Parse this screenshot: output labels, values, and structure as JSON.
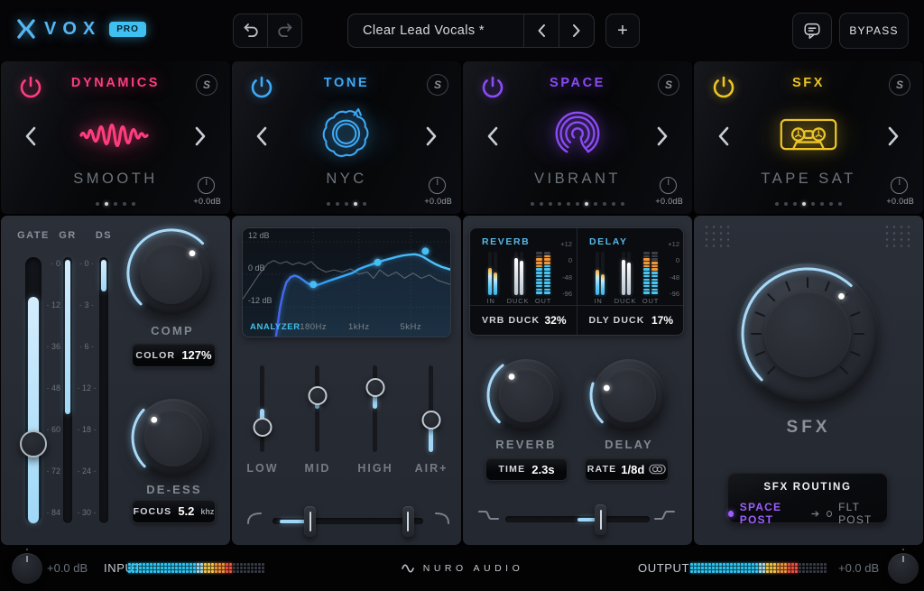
{
  "top_bar": {
    "vox": "VOX",
    "pro": "PRO",
    "preset_name": "Clear Lead Vocals *",
    "plus": "+",
    "bypass": "BYPASS"
  },
  "modules": [
    {
      "title": "DYNAMICS",
      "preset": "SMOOTH",
      "gain": "+0.0dB",
      "solo": "S",
      "color": "#ff3d7e",
      "dots": 5,
      "active_dot": 2
    },
    {
      "title": "TONE",
      "preset": "NYC",
      "gain": "+0.0dB",
      "solo": "S",
      "color": "#3fa9f5",
      "dots": 5,
      "active_dot": 4
    },
    {
      "title": "SPACE",
      "preset": "VIBRANT",
      "gain": "+0.0dB",
      "solo": "S",
      "color": "#8b4bf5",
      "dots": 11,
      "active_dot": 7
    },
    {
      "title": "SFX",
      "preset": "TAPE SAT",
      "gain": "+0.0dB",
      "solo": "S",
      "color": "#ecc427",
      "dots": 8,
      "active_dot": 4
    }
  ],
  "dynamics": {
    "gate": {
      "label": "GATE",
      "scale": [
        "0",
        "12",
        "36",
        "48",
        "60",
        "72",
        "84"
      ],
      "thumb": 0.7,
      "fill_from": 0.15,
      "fill_to": 1
    },
    "gr": {
      "label": "GR",
      "scale": [
        "0",
        "3",
        "6",
        "12",
        "18",
        "24",
        "30"
      ],
      "fill_from": 0.01,
      "fill_to": 0.59
    },
    "ds": {
      "label": "DS",
      "fill_from": 0.01,
      "fill_to": 0.13
    },
    "comp": {
      "label": "COMP",
      "arc": {
        "start": -135,
        "end": 46,
        "dot": 46
      }
    },
    "color_display": {
      "label": "COLOR",
      "value": "127%"
    },
    "deess": {
      "label": "DE-ESS",
      "arc": {
        "start": -135,
        "end": -47,
        "dot": -47
      }
    },
    "focus_display": {
      "label": "FOCUS",
      "value": "5.2",
      "unit": "khz"
    }
  },
  "tone": {
    "eq": {
      "analyzer_label": "ANALYZER",
      "db_labels": [
        "12 dB",
        "0 dB",
        "-12 dB"
      ],
      "freq_labels": [
        "180Hz",
        "1kHz",
        "5kHz"
      ],
      "grid_y": [
        6.5,
        22.2,
        37.8
      ],
      "grid_x": [
        34,
        56,
        81
      ],
      "curve": [
        [
          16,
          52
        ],
        [
          17,
          45
        ],
        [
          18,
          38
        ],
        [
          19.5,
          31
        ],
        [
          21,
          26
        ],
        [
          23,
          23.5
        ],
        [
          25,
          22.7
        ],
        [
          27,
          23.4
        ],
        [
          29,
          24.8
        ],
        [
          31,
          26.3
        ],
        [
          33,
          27.2
        ],
        [
          34.5,
          27.5
        ],
        [
          36,
          27.2
        ],
        [
          38,
          26.5
        ],
        [
          41,
          25.4
        ],
        [
          44,
          24.4
        ],
        [
          47,
          23.4
        ],
        [
          50,
          22.4
        ],
        [
          53,
          21.4
        ],
        [
          56,
          19.6
        ],
        [
          59,
          18.4
        ],
        [
          62,
          17.4
        ],
        [
          65,
          16.4
        ],
        [
          68,
          15.4
        ],
        [
          71,
          14.6
        ],
        [
          74,
          13.8
        ],
        [
          77,
          13.1
        ],
        [
          80,
          12.7
        ],
        [
          83,
          12.5
        ],
        [
          85,
          12.9
        ],
        [
          87,
          13.8
        ],
        [
          90,
          15.6
        ],
        [
          93,
          17.3
        ],
        [
          96,
          18.6
        ],
        [
          100,
          19.8
        ]
      ],
      "analyzer": [
        [
          0,
          34
        ],
        [
          4,
          28
        ],
        [
          8,
          22
        ],
        [
          12,
          17
        ],
        [
          15,
          15.5
        ],
        [
          18,
          17
        ],
        [
          21,
          16
        ],
        [
          24,
          17.5
        ],
        [
          27,
          16.5
        ],
        [
          30,
          17.5
        ],
        [
          33,
          16
        ],
        [
          36,
          19
        ],
        [
          40,
          21
        ],
        [
          44,
          20
        ],
        [
          48,
          21
        ],
        [
          52,
          19.5
        ],
        [
          56,
          22
        ],
        [
          60,
          21
        ],
        [
          63,
          24
        ],
        [
          66,
          20
        ],
        [
          70,
          23
        ],
        [
          74,
          21
        ],
        [
          78,
          24
        ],
        [
          82,
          21.5
        ],
        [
          86,
          24
        ],
        [
          90,
          22.5
        ],
        [
          94,
          25
        ],
        [
          100,
          27
        ]
      ],
      "nodes": [
        [
          34,
          27
        ],
        [
          65,
          16.4
        ],
        [
          88,
          11
        ]
      ]
    },
    "sliders": [
      {
        "label": "LOW",
        "pos": 0.71,
        "anchor": 0.5
      },
      {
        "label": "MID",
        "pos": 0.35,
        "anchor": 0.5
      },
      {
        "label": "HIGH",
        "pos": 0.26,
        "anchor": 0.5
      },
      {
        "label": "AIR+",
        "pos": 0.63,
        "anchor": 1
      }
    ],
    "filter_slider": {
      "handles": [
        0.25,
        0.9
      ],
      "fill": [
        0.045,
        0.25
      ]
    }
  },
  "space": {
    "units": [
      {
        "title": "REVERB",
        "legend": [
          "IN",
          "DUCK",
          "OUT"
        ],
        "scale": [
          "+12",
          "0",
          "-48",
          "-96"
        ],
        "in_bars": [
          0.62,
          0.52
        ],
        "duck_bars": [
          0.86,
          0.8
        ],
        "out_cols": [
          {
            "dim": 2,
            "orange": 3,
            "cyan": 8
          },
          {
            "dim": 1,
            "orange": 3,
            "cyan": 9
          }
        ],
        "duck_label": "VRB DUCK",
        "duck_value": "32%"
      },
      {
        "title": "DELAY",
        "legend": [
          "IN",
          "DUCK",
          "OUT"
        ],
        "scale": [
          "+12",
          "0",
          "-48",
          "-96"
        ],
        "in_bars": [
          0.58,
          0.48
        ],
        "duck_bars": [
          0.82,
          0.76
        ],
        "out_cols": [
          {
            "dim": 2,
            "orange": 3,
            "cyan": 8
          },
          {
            "dim": 3,
            "orange": 3,
            "cyan": 7
          }
        ],
        "duck_label": "DLY DUCK",
        "duck_value": "17%"
      }
    ],
    "reverb": {
      "label": "REVERB",
      "arc": {
        "start": -135,
        "end": -38,
        "dot": -38
      }
    },
    "delay": {
      "label": "DELAY",
      "arc": {
        "start": -135,
        "end": -72,
        "dot": -72
      }
    },
    "time_display": {
      "label": "TIME",
      "value": "2.3s"
    },
    "rate_display": {
      "label": "RATE",
      "value": "1/8d"
    },
    "duck_slider": {
      "handles": [
        0.66
      ],
      "fill": [
        0.5,
        0.66
      ]
    }
  },
  "sfx": {
    "knob_label": "SFX",
    "knob": {
      "arc": {
        "start": -135,
        "end": 42,
        "dot": 42
      }
    },
    "routing": {
      "title": "SFX ROUTING",
      "from": "SPACE POST",
      "to": "FLT POST"
    }
  },
  "io": {
    "input": {
      "db": "+0.0 dB",
      "label": "INPUT",
      "lit": 0.78
    },
    "output": {
      "db": "+0.0 dB",
      "label": "OUTPUT",
      "lit": 0.8
    },
    "brand": "NURO AUDIO",
    "stops": [
      {
        "to": 0.5,
        "color": "#2fc6f2"
      },
      {
        "to": 0.56,
        "color": "#a5def2"
      },
      {
        "to": 0.63,
        "color": "#f2c84b"
      },
      {
        "to": 0.71,
        "color": "#f2953c"
      },
      {
        "to": 1.01,
        "color": "#ef5340"
      }
    ],
    "dim": "#363a44"
  }
}
